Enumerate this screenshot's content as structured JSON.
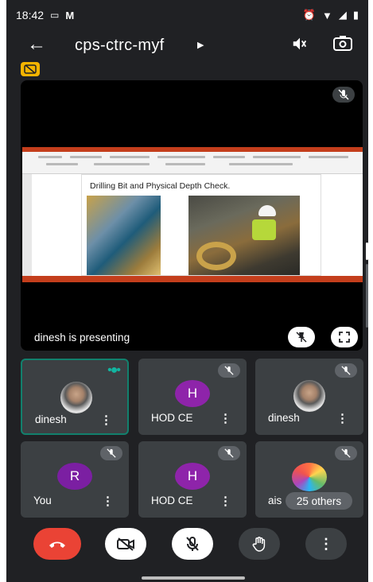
{
  "status_bar": {
    "time": "18:42"
  },
  "header": {
    "meeting_code": "cps-ctrc-myf"
  },
  "stage": {
    "slide_title": "Drilling Bit and Physical Depth Check.",
    "presenting_text": "dinesh is presenting"
  },
  "tiles": [
    {
      "name": "dinesh",
      "avatar": "photo",
      "muted": false,
      "speaking": true
    },
    {
      "name": "HOD CE",
      "avatar_letter": "H",
      "muted": true
    },
    {
      "name": "dinesh",
      "avatar": "photo",
      "muted": true
    },
    {
      "name": "You",
      "avatar_letter": "R",
      "muted": true
    },
    {
      "name": "HOD CE",
      "avatar_letter": "H",
      "muted": true
    },
    {
      "name_prefix": "ais",
      "others_label": "25 others",
      "muted": true
    }
  ],
  "colors": {
    "end_call": "#ea4335",
    "speaking_accent": "#12806d",
    "avatar_purple": "#8e24aa",
    "cc_badge": "#f5b400"
  },
  "icons": [
    "back-arrow-icon",
    "audio-output-icon",
    "camera-flip-icon",
    "captions-off-icon",
    "mic-off-icon",
    "unpin-icon",
    "fullscreen-icon",
    "end-call-icon",
    "camera-off-icon",
    "raise-hand-icon",
    "more-vert-icon"
  ]
}
